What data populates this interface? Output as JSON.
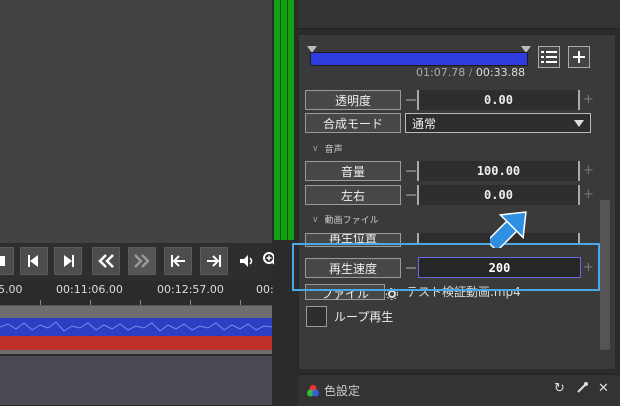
{
  "timeline": {
    "ticks": [
      "5.00",
      "00:11:06.00",
      "00:12:57.00",
      "00:"
    ]
  },
  "player": {
    "current_time": "01:07.78",
    "separator": "/",
    "total_time": "00:33.88"
  },
  "properties": {
    "opacity": {
      "label": "透明度",
      "value": "0.00"
    },
    "blend_mode": {
      "label": "合成モード",
      "value": "通常"
    },
    "audio_section": "音声",
    "volume": {
      "label": "音量",
      "value": "100.00"
    },
    "pan": {
      "label": "左右",
      "value": "0.00"
    },
    "video_file_section": "動画ファイル",
    "play_position": {
      "label": "再生位置"
    },
    "play_speed": {
      "label": "再生速度",
      "value": "200"
    },
    "file": {
      "label": "ファイル",
      "value": "テスト検証動画.mp4"
    },
    "loop": {
      "label": "ループ再生"
    }
  },
  "color_panel": {
    "title": "色設定"
  },
  "colors": {
    "highlight": "#4aa8e8",
    "pointer": "#2f8fe0",
    "meter": "#14a014",
    "seekbar": "#2f3de0"
  }
}
